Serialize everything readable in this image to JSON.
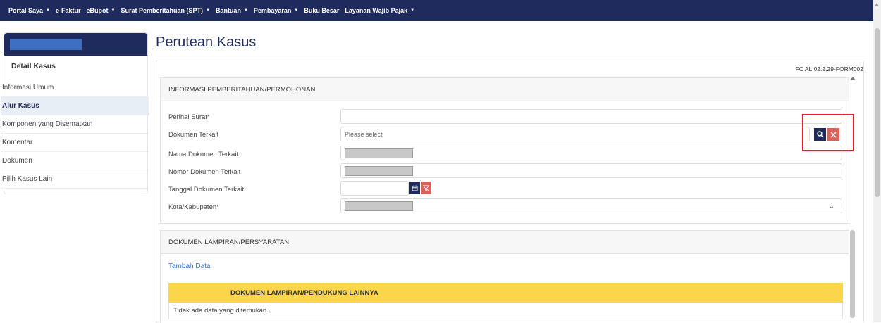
{
  "nav": {
    "items": [
      {
        "label": "Portal Saya",
        "caret": true
      },
      {
        "label": "e-Faktur",
        "caret": false
      },
      {
        "label": "eBupot",
        "caret": true
      },
      {
        "label": "Surat Pemberitahuan (SPT)",
        "caret": true
      },
      {
        "label": "Bantuan",
        "caret": true
      },
      {
        "label": "Pembayaran",
        "caret": true
      },
      {
        "label": "Buku Besar",
        "caret": false
      },
      {
        "label": "Layanan Wajib Pajak",
        "caret": true
      }
    ]
  },
  "sidebar": {
    "title": "Detail Kasus",
    "items": [
      {
        "label": "Informasi Umum",
        "active": false
      },
      {
        "label": "Alur Kasus",
        "active": true
      },
      {
        "label": "Komponen yang Disematkan",
        "active": false
      },
      {
        "label": "Komentar",
        "active": false
      },
      {
        "label": "Dokumen",
        "active": false
      },
      {
        "label": "Pilih Kasus Lain",
        "active": false
      }
    ]
  },
  "page": {
    "title": "Perutean Kasus",
    "form_code": "FC AL.02.2.29-FORM002"
  },
  "section_info": {
    "title": "INFORMASI PEMBERITAHUAN/PERMOHONAN",
    "fields": {
      "perihal_label": "Perihal Surat*",
      "perihal_value": "",
      "dokumen_terkait_label": "Dokumen Terkait",
      "dokumen_terkait_placeholder": "Please select",
      "nama_dokumen_label": "Nama Dokumen Terkait",
      "nomor_dokumen_label": "Nomor Dokumen Terkait",
      "tanggal_dokumen_label": "Tanggal Dokumen Terkait",
      "tanggal_dokumen_value": "",
      "kota_label": "Kota/Kabupaten*"
    }
  },
  "section_docs": {
    "title": "DOKUMEN LAMPIRAN/PERSYARATAN",
    "add_link": "Tambah Data",
    "table_header": "DOKUMEN LAMPIRAN/PENDUKUNG LAINNYA",
    "empty_message": "Tidak ada data yang ditemukan."
  },
  "icons": {
    "search": "search-icon",
    "clear": "close-icon",
    "calendar": "calendar-icon",
    "clear_filter": "filter-clear-icon",
    "dropdown": "chevron-down-icon",
    "caret": "▼",
    "chevron": "⌄"
  },
  "colors": {
    "nav_bg": "#1e2b5c",
    "accent_red": "#d9625b",
    "table_header_bg": "#fcd64a",
    "link": "#2f6fc4"
  }
}
